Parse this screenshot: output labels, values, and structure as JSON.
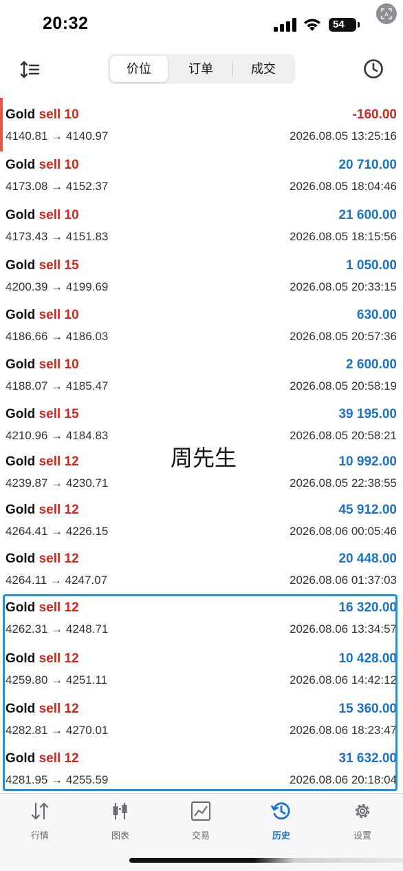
{
  "status_bar": {
    "time": "20:32",
    "battery": "54"
  },
  "header": {
    "tabs": [
      {
        "label": "价位",
        "active": true
      },
      {
        "label": "订单",
        "active": false
      },
      {
        "label": "成交",
        "active": false
      }
    ]
  },
  "colors": {
    "sell": "#d6261c",
    "profit_positive": "#1a73c8",
    "profit_negative": "#d6261c",
    "highlight_border": "#1e90e0"
  },
  "trades": [
    {
      "symbol": "Gold",
      "side_qty": "sell 10",
      "prices": "4140.81 → 4140.97",
      "profit": "-160.00",
      "time": "2026.08.05 13:25:16"
    },
    {
      "symbol": "Gold",
      "side_qty": "sell 10",
      "prices": "4173.08 → 4152.37",
      "profit": "20 710.00",
      "time": "2026.08.05 18:04:46"
    },
    {
      "symbol": "Gold",
      "side_qty": "sell 10",
      "prices": "4173.43 → 4151.83",
      "profit": "21 600.00",
      "time": "2026.08.05 18:15:56"
    },
    {
      "symbol": "Gold",
      "side_qty": "sell 15",
      "prices": "4200.39 → 4199.69",
      "profit": "1 050.00",
      "time": "2026.08.05 20:33:15"
    },
    {
      "symbol": "Gold",
      "side_qty": "sell 10",
      "prices": "4186.66 → 4186.03",
      "profit": "630.00",
      "time": "2026.08.05 20:57:36"
    },
    {
      "symbol": "Gold",
      "side_qty": "sell 10",
      "prices": "4188.07 → 4185.47",
      "profit": "2 600.00",
      "time": "2026.08.05 20:58:19"
    },
    {
      "symbol": "Gold",
      "side_qty": "sell 15",
      "prices": "4210.96 → 4184.83",
      "profit": "39 195.00",
      "time": "2026.08.05 20:58:21"
    },
    {
      "symbol": "Gold",
      "side_qty": "sell 12",
      "prices": "4239.87 → 4230.71",
      "profit": "10 992.00",
      "time": "2026.08.05 22:38:55"
    },
    {
      "symbol": "Gold",
      "side_qty": "sell 12",
      "prices": "4264.41 → 4226.15",
      "profit": "45 912.00",
      "time": "2026.08.06 00:05:46"
    },
    {
      "symbol": "Gold",
      "side_qty": "sell 12",
      "prices": "4264.11 → 4247.07",
      "profit": "20 448.00",
      "time": "2026.08.06 01:37:03"
    },
    {
      "symbol": "Gold",
      "side_qty": "sell 12",
      "prices": "4262.31 → 4248.71",
      "profit": "16 320.00",
      "time": "2026.08.06 13:34:57"
    },
    {
      "symbol": "Gold",
      "side_qty": "sell 12",
      "prices": "4259.80 → 4251.11",
      "profit": "10 428.00",
      "time": "2026.08.06 14:42:12"
    },
    {
      "symbol": "Gold",
      "side_qty": "sell 12",
      "prices": "4282.81 → 4270.01",
      "profit": "15 360.00",
      "time": "2026.08.06 18:23:47"
    },
    {
      "symbol": "Gold",
      "side_qty": "sell 12",
      "prices": "4281.95 → 4255.59",
      "profit": "31 632.00",
      "time": "2026.08.06 20:18:04"
    }
  ],
  "watermark": "周先生",
  "tab_bar": [
    {
      "label": "行情",
      "icon": "quotes-arrows-icon",
      "active": false
    },
    {
      "label": "图表",
      "icon": "candlestick-icon",
      "active": false
    },
    {
      "label": "交易",
      "icon": "trade-chart-icon",
      "active": false
    },
    {
      "label": "历史",
      "icon": "history-clock-icon",
      "active": true
    },
    {
      "label": "设置",
      "icon": "gear-icon",
      "active": false
    }
  ]
}
